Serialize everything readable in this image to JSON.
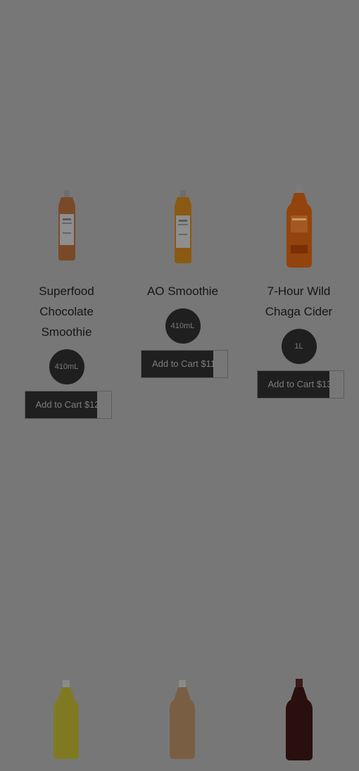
{
  "products": [
    {
      "name": "Superfood Chocolate Smoothie",
      "name_lines": [
        "Superfood",
        "Chocolate",
        "Smoothie"
      ],
      "size": "410mL",
      "cart_label": "Add to Cart $12",
      "color": "#a8693b",
      "icon": "smoothie-bottle-icon"
    },
    {
      "name": "AO Smoothie",
      "name_lines": [
        "AO Smoothie"
      ],
      "size": "410mL",
      "cart_label": "Add to Cart $11",
      "color": "#b1721f",
      "icon": "smoothie-bottle-icon"
    },
    {
      "name": "7-Hour Wild Chaga Cider",
      "name_lines": [
        "7-Hour Wild",
        "Chaga Cider"
      ],
      "size": "1L",
      "cart_label": "Add to Cart $13",
      "color": "#b45a14",
      "icon": "cider-bottle-icon"
    }
  ],
  "next_row_bottles": [
    {
      "color": "#8e8a2a",
      "icon": "bottle-icon"
    },
    {
      "color": "#8c6b4c",
      "icon": "bottle-icon"
    },
    {
      "color": "#2a0f0f",
      "icon": "bottle-icon"
    }
  ]
}
